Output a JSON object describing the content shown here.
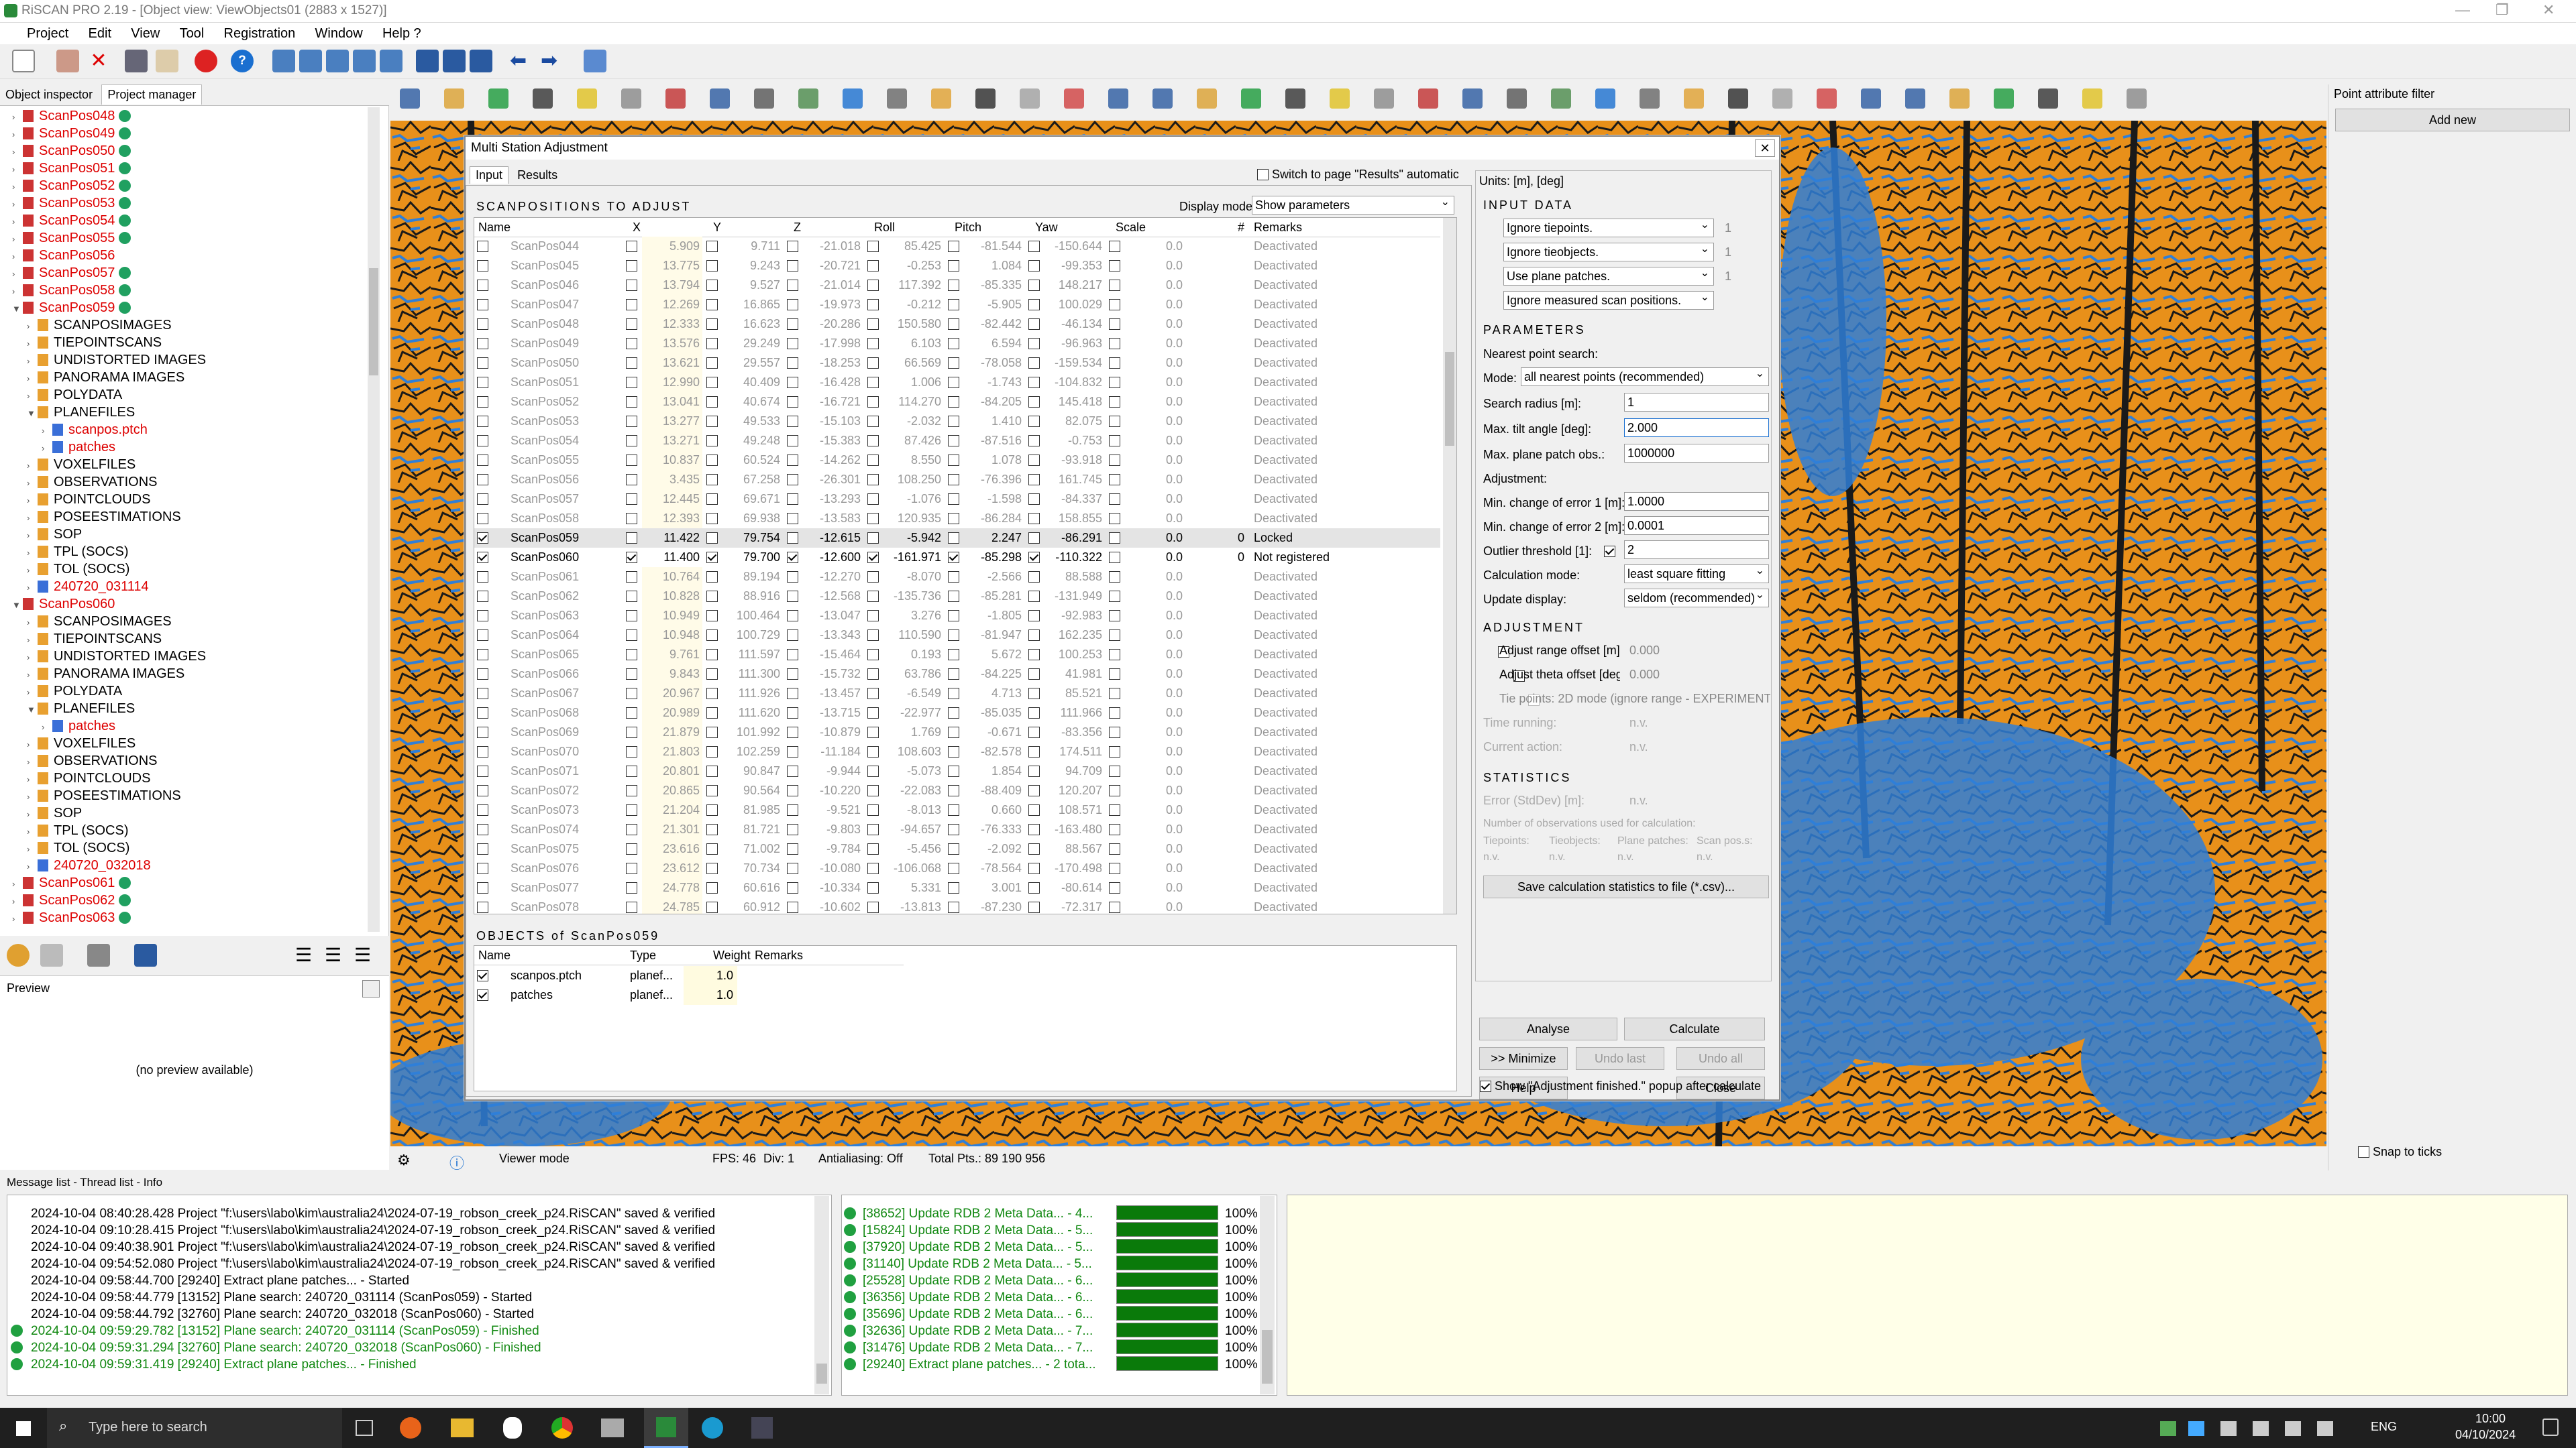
{
  "window": {
    "title": "RiSCAN PRO 2.19 - [Object view: ViewObjects01 (2883 x 1527)]"
  },
  "menu": [
    "Project",
    "Edit",
    "View",
    "Tool",
    "Registration",
    "Window",
    "Help ?"
  ],
  "left_tabs": [
    "Object inspector",
    "Project manager"
  ],
  "tree": [
    {
      "label": "ScanPos048",
      "indent": 1,
      "red": true,
      "ok": true
    },
    {
      "label": "ScanPos049",
      "indent": 1,
      "red": true,
      "ok": true
    },
    {
      "label": "ScanPos050",
      "indent": 1,
      "red": true,
      "ok": true
    },
    {
      "label": "ScanPos051",
      "indent": 1,
      "red": true,
      "ok": true
    },
    {
      "label": "ScanPos052",
      "indent": 1,
      "red": true,
      "ok": true
    },
    {
      "label": "ScanPos053",
      "indent": 1,
      "red": true,
      "ok": true
    },
    {
      "label": "ScanPos054",
      "indent": 1,
      "red": true,
      "ok": true
    },
    {
      "label": "ScanPos055",
      "indent": 1,
      "red": true,
      "ok": true
    },
    {
      "label": "ScanPos056",
      "indent": 1,
      "red": true,
      "ok": false
    },
    {
      "label": "ScanPos057",
      "indent": 1,
      "red": true,
      "ok": true
    },
    {
      "label": "ScanPos058",
      "indent": 1,
      "red": true,
      "ok": true
    },
    {
      "label": "ScanPos059",
      "indent": 1,
      "red": true,
      "ok": true,
      "open": true
    },
    {
      "label": "SCANPOSIMAGES",
      "indent": 2
    },
    {
      "label": "TIEPOINTSCANS",
      "indent": 2
    },
    {
      "label": "UNDISTORTED IMAGES",
      "indent": 2
    },
    {
      "label": "PANORAMA IMAGES",
      "indent": 2
    },
    {
      "label": "POLYDATA",
      "indent": 2
    },
    {
      "label": "PLANEFILES",
      "indent": 2,
      "open": true
    },
    {
      "label": "scanpos.ptch",
      "indent": 3,
      "red": true
    },
    {
      "label": "patches",
      "indent": 3,
      "red": true
    },
    {
      "label": "VOXELFILES",
      "indent": 2
    },
    {
      "label": "OBSERVATIONS",
      "indent": 2
    },
    {
      "label": "POINTCLOUDS",
      "indent": 2
    },
    {
      "label": "POSEESTIMATIONS",
      "indent": 2
    },
    {
      "label": "SOP",
      "indent": 2
    },
    {
      "label": "TPL (SOCS)",
      "indent": 2
    },
    {
      "label": "TOL (SOCS)",
      "indent": 2
    },
    {
      "label": "240720_031114",
      "indent": 2,
      "red": true
    },
    {
      "label": "ScanPos060",
      "indent": 1,
      "red": true,
      "open": true
    },
    {
      "label": "SCANPOSIMAGES",
      "indent": 2
    },
    {
      "label": "TIEPOINTSCANS",
      "indent": 2
    },
    {
      "label": "UNDISTORTED IMAGES",
      "indent": 2
    },
    {
      "label": "PANORAMA IMAGES",
      "indent": 2
    },
    {
      "label": "POLYDATA",
      "indent": 2
    },
    {
      "label": "PLANEFILES",
      "indent": 2,
      "open": true
    },
    {
      "label": "patches",
      "indent": 3,
      "red": true
    },
    {
      "label": "VOXELFILES",
      "indent": 2
    },
    {
      "label": "OBSERVATIONS",
      "indent": 2
    },
    {
      "label": "POINTCLOUDS",
      "indent": 2
    },
    {
      "label": "POSEESTIMATIONS",
      "indent": 2
    },
    {
      "label": "SOP",
      "indent": 2
    },
    {
      "label": "TPL (SOCS)",
      "indent": 2
    },
    {
      "label": "TOL (SOCS)",
      "indent": 2
    },
    {
      "label": "240720_032018",
      "indent": 2,
      "red": true
    },
    {
      "label": "ScanPos061",
      "indent": 1,
      "red": true,
      "ok": true
    },
    {
      "label": "ScanPos062",
      "indent": 1,
      "red": true,
      "ok": true
    },
    {
      "label": "ScanPos063",
      "indent": 1,
      "red": true,
      "ok": true
    }
  ],
  "preview": {
    "title": "Preview",
    "empty_text": "(no preview available)"
  },
  "viewer": {
    "mode": "Viewer mode",
    "fps": "FPS: 46",
    "div": "Div: 1",
    "aa": "Antialiasing: Off",
    "total": "Total Pts.: 89 190 956",
    "snap": "Snap to ticks"
  },
  "right_panel": {
    "title": "Point attribute filter",
    "add_button": "Add new"
  },
  "dialog": {
    "title": "Multi Station Adjustment",
    "tabs": [
      "Input",
      "Results"
    ],
    "switch_label": "Switch to page \"Results\" automatically",
    "section_title": "SCANPOSITIONS TO ADJUST",
    "display_mode_label": "Display mode",
    "display_mode_value": "Show parameters",
    "columns": [
      "Name",
      "X",
      "Y",
      "Z",
      "Roll",
      "Pitch",
      "Yaw",
      "Scale",
      "#",
      "Remarks"
    ],
    "rows": [
      {
        "name": "ScanPos044",
        "x": "5.909",
        "y": "9.711",
        "z": "-21.018",
        "roll": "85.425",
        "pitch": "-81.544",
        "yaw": "-150.644",
        "scale": "0.0",
        "n": "",
        "remarks": "Deactivated"
      },
      {
        "name": "ScanPos045",
        "x": "13.775",
        "y": "9.243",
        "z": "-20.721",
        "roll": "-0.253",
        "pitch": "1.084",
        "yaw": "-99.353",
        "scale": "0.0",
        "n": "",
        "remarks": "Deactivated"
      },
      {
        "name": "ScanPos046",
        "x": "13.794",
        "y": "9.527",
        "z": "-21.014",
        "roll": "117.392",
        "pitch": "-85.335",
        "yaw": "148.217",
        "scale": "0.0",
        "n": "",
        "remarks": "Deactivated"
      },
      {
        "name": "ScanPos047",
        "x": "12.269",
        "y": "16.865",
        "z": "-19.973",
        "roll": "-0.212",
        "pitch": "-5.905",
        "yaw": "100.029",
        "scale": "0.0",
        "n": "",
        "remarks": "Deactivated"
      },
      {
        "name": "ScanPos048",
        "x": "12.333",
        "y": "16.623",
        "z": "-20.286",
        "roll": "150.580",
        "pitch": "-82.442",
        "yaw": "-46.134",
        "scale": "0.0",
        "n": "",
        "remarks": "Deactivated"
      },
      {
        "name": "ScanPos049",
        "x": "13.576",
        "y": "29.249",
        "z": "-17.998",
        "roll": "6.103",
        "pitch": "6.594",
        "yaw": "-96.963",
        "scale": "0.0",
        "n": "",
        "remarks": "Deactivated"
      },
      {
        "name": "ScanPos050",
        "x": "13.621",
        "y": "29.557",
        "z": "-18.253",
        "roll": "66.569",
        "pitch": "-78.058",
        "yaw": "-159.534",
        "scale": "0.0",
        "n": "",
        "remarks": "Deactivated"
      },
      {
        "name": "ScanPos051",
        "x": "12.990",
        "y": "40.409",
        "z": "-16.428",
        "roll": "1.006",
        "pitch": "-1.743",
        "yaw": "-104.832",
        "scale": "0.0",
        "n": "",
        "remarks": "Deactivated"
      },
      {
        "name": "ScanPos052",
        "x": "13.041",
        "y": "40.674",
        "z": "-16.721",
        "roll": "114.270",
        "pitch": "-84.205",
        "yaw": "145.418",
        "scale": "0.0",
        "n": "",
        "remarks": "Deactivated"
      },
      {
        "name": "ScanPos053",
        "x": "13.277",
        "y": "49.533",
        "z": "-15.103",
        "roll": "-2.032",
        "pitch": "1.410",
        "yaw": "82.075",
        "scale": "0.0",
        "n": "",
        "remarks": "Deactivated"
      },
      {
        "name": "ScanPos054",
        "x": "13.271",
        "y": "49.248",
        "z": "-15.383",
        "roll": "87.426",
        "pitch": "-87.516",
        "yaw": "-0.753",
        "scale": "0.0",
        "n": "",
        "remarks": "Deactivated"
      },
      {
        "name": "ScanPos055",
        "x": "10.837",
        "y": "60.524",
        "z": "-14.262",
        "roll": "8.550",
        "pitch": "1.078",
        "yaw": "-93.918",
        "scale": "0.0",
        "n": "",
        "remarks": "Deactivated"
      },
      {
        "name": "ScanPos056",
        "x": "3.435",
        "y": "67.258",
        "z": "-26.301",
        "roll": "108.250",
        "pitch": "-76.396",
        "yaw": "161.745",
        "scale": "0.0",
        "n": "",
        "remarks": "Deactivated"
      },
      {
        "name": "ScanPos057",
        "x": "12.445",
        "y": "69.671",
        "z": "-13.293",
        "roll": "-1.076",
        "pitch": "-1.598",
        "yaw": "-84.337",
        "scale": "0.0",
        "n": "",
        "remarks": "Deactivated"
      },
      {
        "name": "ScanPos058",
        "x": "12.393",
        "y": "69.938",
        "z": "-13.583",
        "roll": "120.935",
        "pitch": "-86.284",
        "yaw": "158.855",
        "scale": "0.0",
        "n": "",
        "remarks": "Deactivated"
      },
      {
        "name": "ScanPos059",
        "x": "11.422",
        "y": "79.754",
        "z": "-12.615",
        "roll": "-5.942",
        "pitch": "2.247",
        "yaw": "-86.291",
        "scale": "0.0",
        "n": "0",
        "remarks": "Locked",
        "active": true,
        "selected": true
      },
      {
        "name": "ScanPos060",
        "x": "11.400",
        "y": "79.700",
        "z": "-12.600",
        "roll": "-161.971",
        "pitch": "-85.298",
        "yaw": "-110.322",
        "scale": "0.0",
        "n": "0",
        "remarks": "Not registered",
        "active": true,
        "allchecked": true
      },
      {
        "name": "ScanPos061",
        "x": "10.764",
        "y": "89.194",
        "z": "-12.270",
        "roll": "-8.070",
        "pitch": "-2.566",
        "yaw": "88.588",
        "scale": "0.0",
        "n": "",
        "remarks": "Deactivated"
      },
      {
        "name": "ScanPos062",
        "x": "10.828",
        "y": "88.916",
        "z": "-12.568",
        "roll": "-135.736",
        "pitch": "-85.281",
        "yaw": "-131.949",
        "scale": "0.0",
        "n": "",
        "remarks": "Deactivated"
      },
      {
        "name": "ScanPos063",
        "x": "10.949",
        "y": "100.464",
        "z": "-13.047",
        "roll": "3.276",
        "pitch": "-1.805",
        "yaw": "-92.983",
        "scale": "0.0",
        "n": "",
        "remarks": "Deactivated"
      },
      {
        "name": "ScanPos064",
        "x": "10.948",
        "y": "100.729",
        "z": "-13.343",
        "roll": "110.590",
        "pitch": "-81.947",
        "yaw": "162.235",
        "scale": "0.0",
        "n": "",
        "remarks": "Deactivated"
      },
      {
        "name": "ScanPos065",
        "x": "9.761",
        "y": "111.597",
        "z": "-15.464",
        "roll": "0.193",
        "pitch": "5.672",
        "yaw": "100.253",
        "scale": "0.0",
        "n": "",
        "remarks": "Deactivated"
      },
      {
        "name": "ScanPos066",
        "x": "9.843",
        "y": "111.300",
        "z": "-15.732",
        "roll": "63.786",
        "pitch": "-84.225",
        "yaw": "41.981",
        "scale": "0.0",
        "n": "",
        "remarks": "Deactivated"
      },
      {
        "name": "ScanPos067",
        "x": "20.967",
        "y": "111.926",
        "z": "-13.457",
        "roll": "-6.549",
        "pitch": "4.713",
        "yaw": "85.521",
        "scale": "0.0",
        "n": "",
        "remarks": "Deactivated"
      },
      {
        "name": "ScanPos068",
        "x": "20.989",
        "y": "111.620",
        "z": "-13.715",
        "roll": "-22.977",
        "pitch": "-85.035",
        "yaw": "111.966",
        "scale": "0.0",
        "n": "",
        "remarks": "Deactivated"
      },
      {
        "name": "ScanPos069",
        "x": "21.879",
        "y": "101.992",
        "z": "-10.879",
        "roll": "1.769",
        "pitch": "-0.671",
        "yaw": "-83.356",
        "scale": "0.0",
        "n": "",
        "remarks": "Deactivated"
      },
      {
        "name": "ScanPos070",
        "x": "21.803",
        "y": "102.259",
        "z": "-11.184",
        "roll": "108.603",
        "pitch": "-82.578",
        "yaw": "174.511",
        "scale": "0.0",
        "n": "",
        "remarks": "Deactivated"
      },
      {
        "name": "ScanPos071",
        "x": "20.801",
        "y": "90.847",
        "z": "-9.944",
        "roll": "-5.073",
        "pitch": "1.854",
        "yaw": "94.709",
        "scale": "0.0",
        "n": "",
        "remarks": "Deactivated"
      },
      {
        "name": "ScanPos072",
        "x": "20.865",
        "y": "90.564",
        "z": "-10.220",
        "roll": "-22.083",
        "pitch": "-88.409",
        "yaw": "120.207",
        "scale": "0.0",
        "n": "",
        "remarks": "Deactivated"
      },
      {
        "name": "ScanPos073",
        "x": "21.204",
        "y": "81.985",
        "z": "-9.521",
        "roll": "-8.013",
        "pitch": "0.660",
        "yaw": "108.571",
        "scale": "0.0",
        "n": "",
        "remarks": "Deactivated"
      },
      {
        "name": "ScanPos074",
        "x": "21.301",
        "y": "81.721",
        "z": "-9.803",
        "roll": "-94.657",
        "pitch": "-76.333",
        "yaw": "-163.480",
        "scale": "0.0",
        "n": "",
        "remarks": "Deactivated"
      },
      {
        "name": "ScanPos075",
        "x": "23.616",
        "y": "71.002",
        "z": "-9.784",
        "roll": "-5.456",
        "pitch": "-2.092",
        "yaw": "88.567",
        "scale": "0.0",
        "n": "",
        "remarks": "Deactivated"
      },
      {
        "name": "ScanPos076",
        "x": "23.612",
        "y": "70.734",
        "z": "-10.080",
        "roll": "-106.068",
        "pitch": "-78.564",
        "yaw": "-170.498",
        "scale": "0.0",
        "n": "",
        "remarks": "Deactivated"
      },
      {
        "name": "ScanPos077",
        "x": "24.778",
        "y": "60.616",
        "z": "-10.334",
        "roll": "5.331",
        "pitch": "3.001",
        "yaw": "-80.614",
        "scale": "0.0",
        "n": "",
        "remarks": "Deactivated"
      },
      {
        "name": "ScanPos078",
        "x": "24.785",
        "y": "60.912",
        "z": "-10.602",
        "roll": "-13.813",
        "pitch": "-87.230",
        "yaw": "-72.317",
        "scale": "0.0",
        "n": "",
        "remarks": "Deactivated"
      }
    ],
    "objects_title": "OBJECTS of ScanPos059",
    "obj_columns": [
      "Name",
      "Type",
      "Weight",
      "Remarks"
    ],
    "objects": [
      {
        "name": "scanpos.ptch",
        "type": "planef...",
        "weight": "1.0"
      },
      {
        "name": "patches",
        "type": "planef...",
        "weight": "1.0"
      }
    ],
    "units": "Units: [m], [deg]",
    "input_data_title": "INPUT DATA",
    "input_data": [
      {
        "label": "Ignore tiepoints.",
        "val": "1"
      },
      {
        "label": "Ignore tieobjects.",
        "val": "1"
      },
      {
        "label": "Use plane patches.",
        "val": "1"
      },
      {
        "label": "Ignore measured scan positions.",
        "val": ""
      }
    ],
    "params_title": "PARAMETERS",
    "nearest_label": "Nearest point search:",
    "mode_label": "Mode:",
    "mode_value": "all nearest points (recommended)",
    "search_radius_label": "Search radius [m]:",
    "search_radius": "1",
    "max_tilt_label": "Max. tilt angle [deg]:",
    "max_tilt": "2.000",
    "max_patch_label": "Max. plane patch obs.:",
    "max_patch": "1000000",
    "adjustment_label": "Adjustment:",
    "err1_label": "Min. change of error 1 [m]:",
    "err1": "1.0000",
    "err2_label": "Min. change of error 2 [m]:",
    "err2": "0.0001",
    "outlier_label": "Outlier threshold [1]:",
    "outlier": "2",
    "calc_mode_label": "Calculation mode:",
    "calc_mode": "least square fitting",
    "update_label": "Update display:",
    "update_value": "seldom (recommended)",
    "adj_title": "ADJUSTMENT",
    "range_offset_label": "Adjust range offset [m]",
    "range_offset": "0.000",
    "theta_offset_label": "Adjust theta offset [deg]",
    "theta_offset": "0.000",
    "tie2d_label": "Tie points: 2D mode (ignore range - EXPERIMENTAL)",
    "time_label": "Time running:",
    "time_val": "n.v.",
    "action_label": "Current action:",
    "action_val": "n.v.",
    "stats_title": "STATISTICS",
    "err_label": "Error (StdDev) [m]:",
    "err_val": "n.v.",
    "nobs_label": "Number of observations used for calculation:",
    "obs_cols": [
      "Tiepoints:",
      "Tieobjects:",
      "Plane patches:",
      "Scan pos.s:"
    ],
    "obs_vals": [
      "n.v.",
      "n.v.",
      "n.v.",
      "n.v."
    ],
    "save_stats": "Save calculation statistics to file (*.csv)...",
    "buttons": {
      "analyse": "Analyse",
      "calculate": "Calculate",
      "minimize": ">> Minimize",
      "undo_last": "Undo last",
      "undo_all": "Undo all",
      "help": "Help",
      "close": "Close"
    },
    "popup_label": "Show \"Adjustment finished.\" popup after calculate"
  },
  "messages": {
    "tabs": "Message list - Thread list - Info",
    "log": [
      {
        "t": "2024-10-04 08:40:28.428 Project \"f:\\users\\labo\\kim\\australia24\\2024-07-19_robson_creek_p24.RiSCAN\" saved & verified",
        "g": false
      },
      {
        "t": "2024-10-04 09:10:28.415 Project \"f:\\users\\labo\\kim\\australia24\\2024-07-19_robson_creek_p24.RiSCAN\" saved & verified",
        "g": false
      },
      {
        "t": "2024-10-04 09:40:38.901 Project \"f:\\users\\labo\\kim\\australia24\\2024-07-19_robson_creek_p24.RiSCAN\" saved & verified",
        "g": false
      },
      {
        "t": "2024-10-04 09:54:52.080 Project \"f:\\users\\labo\\kim\\australia24\\2024-07-19_robson_creek_p24.RiSCAN\" saved & verified",
        "g": false
      },
      {
        "t": "2024-10-04 09:58:44.700 [29240] Extract plane patches... - Started",
        "g": false
      },
      {
        "t": "2024-10-04 09:58:44.779 [13152] Plane search: 240720_031114 (ScanPos059) - Started",
        "g": false
      },
      {
        "t": "2024-10-04 09:58:44.792 [32760] Plane search: 240720_032018 (ScanPos060) - Started",
        "g": false
      },
      {
        "t": "2024-10-04 09:59:29.782 [13152] Plane search: 240720_031114 (ScanPos059) - Finished",
        "g": true
      },
      {
        "t": "2024-10-04 09:59:31.294 [32760] Plane search: 240720_032018 (ScanPos060) - Finished",
        "g": true
      },
      {
        "t": "2024-10-04 09:59:31.419 [29240] Extract plane patches... - Finished",
        "g": true
      }
    ],
    "threads": [
      "[38652] Update RDB 2 Meta Data... - 4...",
      "[15824] Update RDB 2 Meta Data... - 5...",
      "[37920] Update RDB 2 Meta Data... - 5...",
      "[31140] Update RDB 2 Meta Data... - 5...",
      "[25528] Update RDB 2 Meta Data... - 6...",
      "[36356] Update RDB 2 Meta Data... - 6...",
      "[35696] Update RDB 2 Meta Data... - 6...",
      "[32636] Update RDB 2 Meta Data... - 7...",
      "[31476] Update RDB 2 Meta Data... - 7...",
      "[29240] Extract plane patches... - 2 tota..."
    ],
    "thread_pct": "100%"
  },
  "taskbar": {
    "search": "Type here to search",
    "lang": "ENG",
    "time": "10:00",
    "date": "04/10/2024"
  },
  "colors": {
    "orange": "#e8901a",
    "blue": "#2f7fd8",
    "accent": "#0a7a0a"
  }
}
